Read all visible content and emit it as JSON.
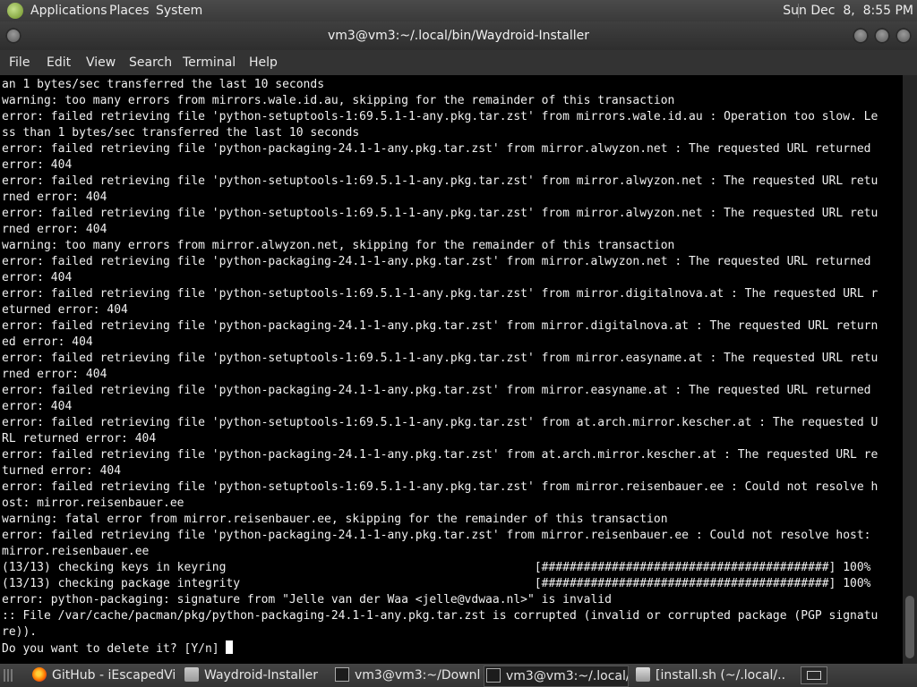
{
  "top_panel": {
    "menus": [
      "Applications",
      "Places",
      "System"
    ],
    "clock": "Sun Dec  8,  8:55 PM",
    "icons": {
      "apps": "gnome-foot-icon"
    }
  },
  "window": {
    "title": "vm3@vm3:~/.local/bin/Waydroid-Installer"
  },
  "menubar": [
    "File",
    "Edit",
    "View",
    "Search",
    "Terminal",
    "Help"
  ],
  "terminal": {
    "lines": [
      "an 1 bytes/sec transferred the last 10 seconds",
      "warning: too many errors from mirrors.wale.id.au, skipping for the remainder of this transaction",
      "error: failed retrieving file 'python-setuptools-1:69.5.1-1-any.pkg.tar.zst' from mirrors.wale.id.au : Operation too slow. Le",
      "ss than 1 bytes/sec transferred the last 10 seconds",
      "error: failed retrieving file 'python-packaging-24.1-1-any.pkg.tar.zst' from mirror.alwyzon.net : The requested URL returned",
      "error: 404",
      "error: failed retrieving file 'python-setuptools-1:69.5.1-1-any.pkg.tar.zst' from mirror.alwyzon.net : The requested URL retu",
      "rned error: 404",
      "error: failed retrieving file 'python-setuptools-1:69.5.1-1-any.pkg.tar.zst' from mirror.alwyzon.net : The requested URL retu",
      "rned error: 404",
      "warning: too many errors from mirror.alwyzon.net, skipping for the remainder of this transaction",
      "error: failed retrieving file 'python-packaging-24.1-1-any.pkg.tar.zst' from mirror.alwyzon.net : The requested URL returned",
      "error: 404",
      "error: failed retrieving file 'python-setuptools-1:69.5.1-1-any.pkg.tar.zst' from mirror.digitalnova.at : The requested URL r",
      "eturned error: 404",
      "error: failed retrieving file 'python-packaging-24.1-1-any.pkg.tar.zst' from mirror.digitalnova.at : The requested URL return",
      "ed error: 404",
      "error: failed retrieving file 'python-setuptools-1:69.5.1-1-any.pkg.tar.zst' from mirror.easyname.at : The requested URL retu",
      "rned error: 404",
      "error: failed retrieving file 'python-packaging-24.1-1-any.pkg.tar.zst' from mirror.easyname.at : The requested URL returned",
      "error: 404",
      "error: failed retrieving file 'python-setuptools-1:69.5.1-1-any.pkg.tar.zst' from at.arch.mirror.kescher.at : The requested U",
      "RL returned error: 404",
      "error: failed retrieving file 'python-packaging-24.1-1-any.pkg.tar.zst' from at.arch.mirror.kescher.at : The requested URL re",
      "turned error: 404",
      "error: failed retrieving file 'python-setuptools-1:69.5.1-1-any.pkg.tar.zst' from mirror.reisenbauer.ee : Could not resolve h",
      "ost: mirror.reisenbauer.ee",
      "warning: fatal error from mirror.reisenbauer.ee, skipping for the remainder of this transaction",
      "error: failed retrieving file 'python-packaging-24.1-1-any.pkg.tar.zst' from mirror.reisenbauer.ee : Could not resolve host:",
      "mirror.reisenbauer.ee",
      "(13/13) checking keys in keyring                                            [#########################################] 100%",
      "(13/13) checking package integrity                                          [#########################################] 100%",
      "error: python-packaging: signature from \"Jelle van der Waa <jelle@vdwaa.nl>\" is invalid",
      ":: File /var/cache/pacman/pkg/python-packaging-24.1-1-any.pkg.tar.zst is corrupted (invalid or corrupted package (PGP signatu",
      "re)).",
      "Do you want to delete it? [Y/n] "
    ]
  },
  "taskbar": {
    "items": [
      {
        "label": "GitHub - iEscapedVi...",
        "icon": "firefox-icon"
      },
      {
        "label": "Waydroid-Installer",
        "icon": "folder-icon"
      },
      {
        "label": "vm3@vm3:~/Downl...",
        "icon": "terminal-icon"
      },
      {
        "label": "vm3@vm3:~/.local/...",
        "icon": "terminal-icon",
        "active": true
      },
      {
        "label": "[install.sh (~/.local/...",
        "icon": "text-editor-icon"
      }
    ]
  }
}
